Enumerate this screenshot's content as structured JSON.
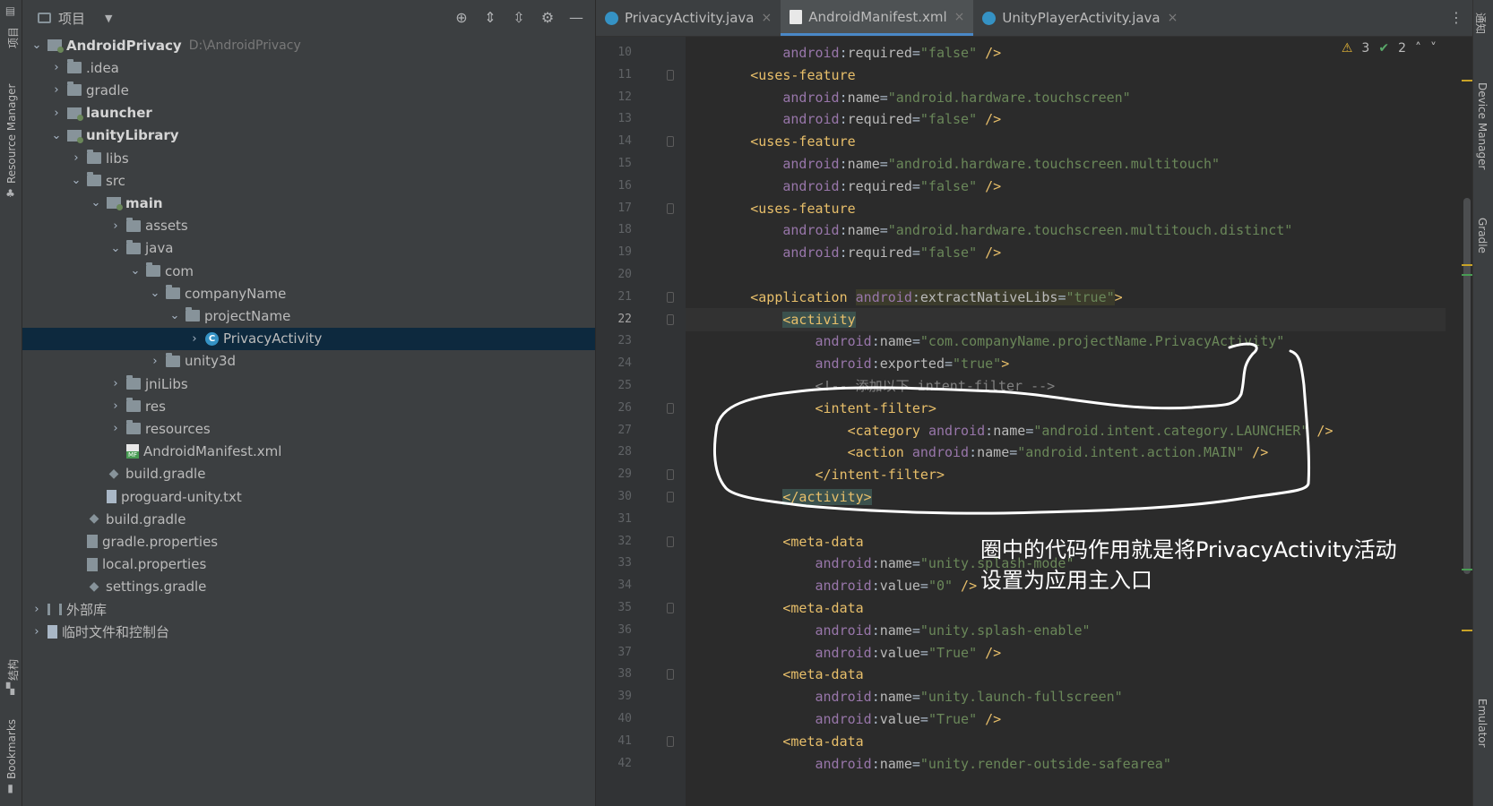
{
  "left_strip": {
    "labels": [
      "项目",
      "Resource Manager",
      "结构",
      "Bookmarks"
    ]
  },
  "right_strip": {
    "labels": [
      "通知",
      "Device Manager",
      "Gradle",
      "Emulator"
    ]
  },
  "project_panel": {
    "title": "项目",
    "tree": [
      {
        "name": "AndroidPrivacy",
        "path": "D:\\AndroidPrivacy",
        "indent": 0,
        "arrow": "down",
        "icon": "module",
        "bold": true
      },
      {
        "name": ".idea",
        "indent": 1,
        "arrow": "right",
        "icon": "folder"
      },
      {
        "name": "gradle",
        "indent": 1,
        "arrow": "right",
        "icon": "folder"
      },
      {
        "name": "launcher",
        "indent": 1,
        "arrow": "right",
        "icon": "module",
        "bold": true
      },
      {
        "name": "unityLibrary",
        "indent": 1,
        "arrow": "down",
        "icon": "module",
        "bold": true
      },
      {
        "name": "libs",
        "indent": 2,
        "arrow": "right",
        "icon": "folder"
      },
      {
        "name": "src",
        "indent": 2,
        "arrow": "down",
        "icon": "folder"
      },
      {
        "name": "main",
        "indent": 3,
        "arrow": "down",
        "icon": "module",
        "bold": true
      },
      {
        "name": "assets",
        "indent": 4,
        "arrow": "right",
        "icon": "folder"
      },
      {
        "name": "java",
        "indent": 4,
        "arrow": "down",
        "icon": "folder"
      },
      {
        "name": "com",
        "indent": 5,
        "arrow": "down",
        "icon": "folder"
      },
      {
        "name": "companyName",
        "indent": 6,
        "arrow": "down",
        "icon": "folder"
      },
      {
        "name": "projectName",
        "indent": 7,
        "arrow": "down",
        "icon": "folder"
      },
      {
        "name": "PrivacyActivity",
        "indent": 8,
        "arrow": "right",
        "icon": "class",
        "selected": true
      },
      {
        "name": "unity3d",
        "indent": 6,
        "arrow": "right",
        "icon": "folder"
      },
      {
        "name": "jniLibs",
        "indent": 4,
        "arrow": "right",
        "icon": "folder"
      },
      {
        "name": "res",
        "indent": 4,
        "arrow": "right",
        "icon": "folder"
      },
      {
        "name": "resources",
        "indent": 4,
        "arrow": "right",
        "icon": "folder"
      },
      {
        "name": "AndroidManifest.xml",
        "indent": 4,
        "arrow": "none",
        "icon": "xml"
      },
      {
        "name": "build.gradle",
        "indent": 3,
        "arrow": "none",
        "icon": "gradle"
      },
      {
        "name": "proguard-unity.txt",
        "indent": 3,
        "arrow": "none",
        "icon": "file"
      },
      {
        "name": "build.gradle",
        "indent": 2,
        "arrow": "none",
        "icon": "gradle"
      },
      {
        "name": "gradle.properties",
        "indent": 2,
        "arrow": "none",
        "icon": "props"
      },
      {
        "name": "local.properties",
        "indent": 2,
        "arrow": "none",
        "icon": "props"
      },
      {
        "name": "settings.gradle",
        "indent": 2,
        "arrow": "none",
        "icon": "gradle"
      },
      {
        "name": "外部库",
        "indent": 0,
        "arrow": "right",
        "icon": "lib"
      },
      {
        "name": "临时文件和控制台",
        "indent": 0,
        "arrow": "right",
        "icon": "file"
      }
    ]
  },
  "editor": {
    "tabs": [
      {
        "label": "PrivacyActivity.java",
        "icon": "class",
        "active": false
      },
      {
        "label": "AndroidManifest.xml",
        "icon": "xml",
        "active": true
      },
      {
        "label": "UnityPlayerActivity.java",
        "icon": "class",
        "active": false
      }
    ],
    "inspection": {
      "warnings": "3",
      "ok": "2"
    },
    "current_line": 22,
    "lines": [
      {
        "no": 10,
        "parts": [
          [
            "",
            "            "
          ],
          [
            "ns",
            "android"
          ],
          [
            "",
            ":"
          ],
          [
            "attr",
            "required"
          ],
          [
            "",
            "="
          ],
          [
            "val",
            "\"false\""
          ],
          [
            "tag",
            " />"
          ]
        ]
      },
      {
        "no": 11,
        "parts": [
          [
            "",
            "        "
          ],
          [
            "tag",
            "<uses-feature"
          ]
        ]
      },
      {
        "no": 12,
        "parts": [
          [
            "",
            "            "
          ],
          [
            "ns",
            "android"
          ],
          [
            "",
            ":"
          ],
          [
            "attr",
            "name"
          ],
          [
            "",
            "="
          ],
          [
            "val",
            "\"android.hardware.touchscreen\""
          ]
        ]
      },
      {
        "no": 13,
        "parts": [
          [
            "",
            "            "
          ],
          [
            "ns",
            "android"
          ],
          [
            "",
            ":"
          ],
          [
            "attr",
            "required"
          ],
          [
            "",
            "="
          ],
          [
            "val",
            "\"false\""
          ],
          [
            "tag",
            " />"
          ]
        ]
      },
      {
        "no": 14,
        "parts": [
          [
            "",
            "        "
          ],
          [
            "tag",
            "<uses-feature"
          ]
        ]
      },
      {
        "no": 15,
        "parts": [
          [
            "",
            "            "
          ],
          [
            "ns",
            "android"
          ],
          [
            "",
            ":"
          ],
          [
            "attr",
            "name"
          ],
          [
            "",
            "="
          ],
          [
            "val",
            "\"android.hardware.touchscreen.multitouch\""
          ]
        ]
      },
      {
        "no": 16,
        "parts": [
          [
            "",
            "            "
          ],
          [
            "ns",
            "android"
          ],
          [
            "",
            ":"
          ],
          [
            "attr",
            "required"
          ],
          [
            "",
            "="
          ],
          [
            "val",
            "\"false\""
          ],
          [
            "tag",
            " />"
          ]
        ]
      },
      {
        "no": 17,
        "parts": [
          [
            "",
            "        "
          ],
          [
            "tag",
            "<uses-feature"
          ]
        ]
      },
      {
        "no": 18,
        "parts": [
          [
            "",
            "            "
          ],
          [
            "ns",
            "android"
          ],
          [
            "",
            ":"
          ],
          [
            "attr",
            "name"
          ],
          [
            "",
            "="
          ],
          [
            "val",
            "\"android.hardware.touchscreen.multitouch.distinct\""
          ]
        ]
      },
      {
        "no": 19,
        "parts": [
          [
            "",
            "            "
          ],
          [
            "ns",
            "android"
          ],
          [
            "",
            ":"
          ],
          [
            "attr",
            "required"
          ],
          [
            "",
            "="
          ],
          [
            "val",
            "\"false\""
          ],
          [
            "tag",
            " />"
          ]
        ]
      },
      {
        "no": 20,
        "parts": []
      },
      {
        "no": 21,
        "parts": [
          [
            "",
            "        "
          ],
          [
            "tag",
            "<application "
          ],
          [
            "ns hl-extract",
            "android"
          ],
          [
            "hl-extract",
            ":"
          ],
          [
            "attr hl-extract",
            "extractNativeLibs"
          ],
          [
            "hl-extract",
            "="
          ],
          [
            "val hl-extract",
            "\"true\""
          ],
          [
            "tag",
            ">"
          ]
        ]
      },
      {
        "no": 22,
        "parts": [
          [
            "",
            "            "
          ],
          [
            "tag hl-activity",
            "<activity"
          ]
        ]
      },
      {
        "no": 23,
        "parts": [
          [
            "",
            "                "
          ],
          [
            "ns",
            "android"
          ],
          [
            "",
            ":"
          ],
          [
            "attr",
            "name"
          ],
          [
            "",
            "="
          ],
          [
            "val",
            "\"com.companyName.projectName.PrivacyActivity\""
          ]
        ]
      },
      {
        "no": 24,
        "parts": [
          [
            "",
            "                "
          ],
          [
            "ns",
            "android"
          ],
          [
            "",
            ":"
          ],
          [
            "attr",
            "exported"
          ],
          [
            "",
            "="
          ],
          [
            "val",
            "\"true\""
          ],
          [
            "tag",
            ">"
          ]
        ]
      },
      {
        "no": 25,
        "parts": [
          [
            "",
            "                "
          ],
          [
            "cm",
            "<!-- 添加以下 intent-filter -->"
          ]
        ]
      },
      {
        "no": 26,
        "parts": [
          [
            "",
            "                "
          ],
          [
            "tag",
            "<intent-filter>"
          ]
        ]
      },
      {
        "no": 27,
        "parts": [
          [
            "",
            "                    "
          ],
          [
            "tag",
            "<category "
          ],
          [
            "ns",
            "android"
          ],
          [
            "",
            ":"
          ],
          [
            "attr",
            "name"
          ],
          [
            "",
            "="
          ],
          [
            "val",
            "\"android.intent.category.LAUNCHER\""
          ],
          [
            "tag",
            " />"
          ]
        ]
      },
      {
        "no": 28,
        "parts": [
          [
            "",
            "                    "
          ],
          [
            "tag",
            "<action "
          ],
          [
            "ns",
            "android"
          ],
          [
            "",
            ":"
          ],
          [
            "attr",
            "name"
          ],
          [
            "",
            "="
          ],
          [
            "val",
            "\"android.intent.action.MAIN\""
          ],
          [
            "tag",
            " />"
          ]
        ]
      },
      {
        "no": 29,
        "parts": [
          [
            "",
            "                "
          ],
          [
            "tag",
            "</intent-filter>"
          ]
        ]
      },
      {
        "no": 30,
        "parts": [
          [
            "",
            "            "
          ],
          [
            "tag hl-activity",
            "</activity>"
          ]
        ]
      },
      {
        "no": 31,
        "parts": []
      },
      {
        "no": 32,
        "parts": [
          [
            "",
            "            "
          ],
          [
            "tag",
            "<meta-data"
          ]
        ]
      },
      {
        "no": 33,
        "parts": [
          [
            "",
            "                "
          ],
          [
            "ns",
            "android"
          ],
          [
            "",
            ":"
          ],
          [
            "attr",
            "name"
          ],
          [
            "",
            "="
          ],
          [
            "val",
            "\"unity.splash-mode\""
          ]
        ]
      },
      {
        "no": 34,
        "parts": [
          [
            "",
            "                "
          ],
          [
            "ns",
            "android"
          ],
          [
            "",
            ":"
          ],
          [
            "attr",
            "value"
          ],
          [
            "",
            "="
          ],
          [
            "val",
            "\"0\""
          ],
          [
            "tag",
            " />"
          ]
        ]
      },
      {
        "no": 35,
        "parts": [
          [
            "",
            "            "
          ],
          [
            "tag",
            "<meta-data"
          ]
        ]
      },
      {
        "no": 36,
        "parts": [
          [
            "",
            "                "
          ],
          [
            "ns",
            "android"
          ],
          [
            "",
            ":"
          ],
          [
            "attr",
            "name"
          ],
          [
            "",
            "="
          ],
          [
            "val",
            "\"unity.splash-enable\""
          ]
        ]
      },
      {
        "no": 37,
        "parts": [
          [
            "",
            "                "
          ],
          [
            "ns",
            "android"
          ],
          [
            "",
            ":"
          ],
          [
            "attr",
            "value"
          ],
          [
            "",
            "="
          ],
          [
            "val",
            "\"True\""
          ],
          [
            "tag",
            " />"
          ]
        ]
      },
      {
        "no": 38,
        "parts": [
          [
            "",
            "            "
          ],
          [
            "tag",
            "<meta-data"
          ]
        ]
      },
      {
        "no": 39,
        "parts": [
          [
            "",
            "                "
          ],
          [
            "ns",
            "android"
          ],
          [
            "",
            ":"
          ],
          [
            "attr",
            "name"
          ],
          [
            "",
            "="
          ],
          [
            "val",
            "\"unity.launch-fullscreen\""
          ]
        ]
      },
      {
        "no": 40,
        "parts": [
          [
            "",
            "                "
          ],
          [
            "ns",
            "android"
          ],
          [
            "",
            ":"
          ],
          [
            "attr",
            "value"
          ],
          [
            "",
            "="
          ],
          [
            "val",
            "\"True\""
          ],
          [
            "tag",
            " />"
          ]
        ]
      },
      {
        "no": 41,
        "parts": [
          [
            "",
            "            "
          ],
          [
            "tag",
            "<meta-data"
          ]
        ]
      },
      {
        "no": 42,
        "parts": [
          [
            "",
            "                "
          ],
          [
            "ns",
            "android"
          ],
          [
            "",
            ":"
          ],
          [
            "attr",
            "name"
          ],
          [
            "",
            "="
          ],
          [
            "val",
            "\"unity.render-outside-safearea\""
          ]
        ]
      }
    ]
  },
  "annotation": {
    "line1": "圈中的代码作用就是将PrivacyActivity活动",
    "line2": "设置为应用主入口"
  },
  "colors": {
    "accent": "#4a88c7",
    "selection": "#0d293e",
    "tag": "#e8bf6a",
    "namespace": "#9876aa",
    "value": "#6a8759",
    "ink": "#ffffff"
  }
}
